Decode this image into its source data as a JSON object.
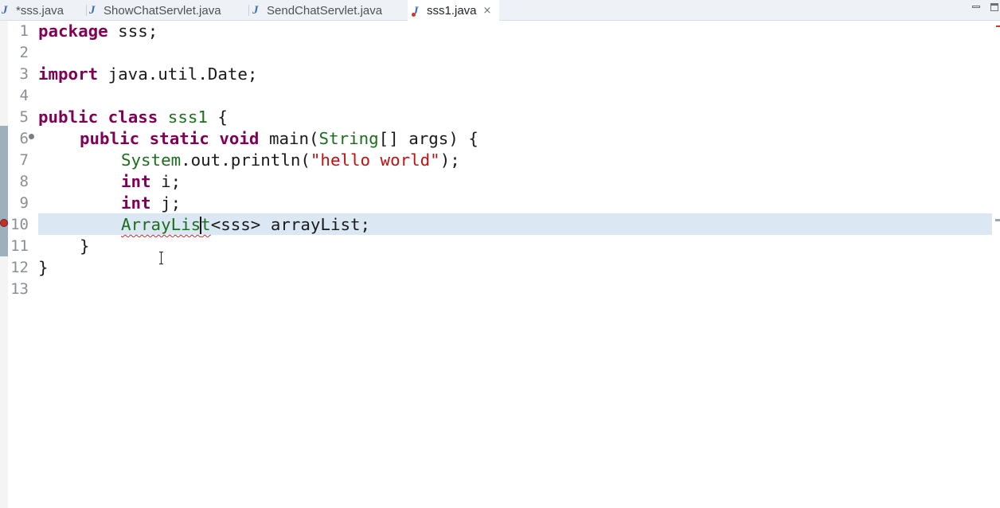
{
  "tabs": [
    {
      "label": "*sss.java",
      "active": false
    },
    {
      "label": "ShowChatServlet.java",
      "active": false
    },
    {
      "label": "SendChatServlet.java",
      "active": false
    },
    {
      "label": "sss1.java",
      "active": true
    }
  ],
  "tab_close_icon": "×",
  "line_numbers": [
    "1",
    "2",
    "3",
    "4",
    "5",
    "6",
    "7",
    "8",
    "9",
    "10",
    "11",
    "12",
    "13"
  ],
  "code": {
    "line1": {
      "kw": "package",
      "rest": " sss;"
    },
    "line3": {
      "kw": "import",
      "rest": " java.util.Date;"
    },
    "line5": {
      "kw1": "public",
      "kw2": "class",
      "name": "sss1",
      "rest": " {"
    },
    "line6": {
      "kw1": "public",
      "kw2": "static",
      "kw3": "void",
      "name": "main(",
      "type": "String",
      "rest": "[] args) {"
    },
    "line7": {
      "obj": "System",
      "mid": ".out.println(",
      "str": "\"hello world\"",
      "rest": ");"
    },
    "line8": {
      "kw": "int",
      "rest": " i;"
    },
    "line9": {
      "kw": "int",
      "rest": " j;"
    },
    "line10": {
      "type_a": "ArrayLis",
      "type_b": "t",
      "rest": "<sss> arrayList;"
    },
    "line11": {
      "rest": "}"
    },
    "line12": {
      "rest": "}"
    }
  },
  "colors": {
    "keyword": "#7f0055",
    "type": "#1b6e1b",
    "string": "#c1120f",
    "current_line": "#dbe7f3",
    "error": "#e0202b"
  },
  "icons": {
    "java_file": "java-file-icon",
    "close": "close-icon",
    "fold": "fold-collapse-icon",
    "error": "error-marker-icon",
    "minimize": "minimize-icon",
    "maximize": "maximize-icon"
  }
}
